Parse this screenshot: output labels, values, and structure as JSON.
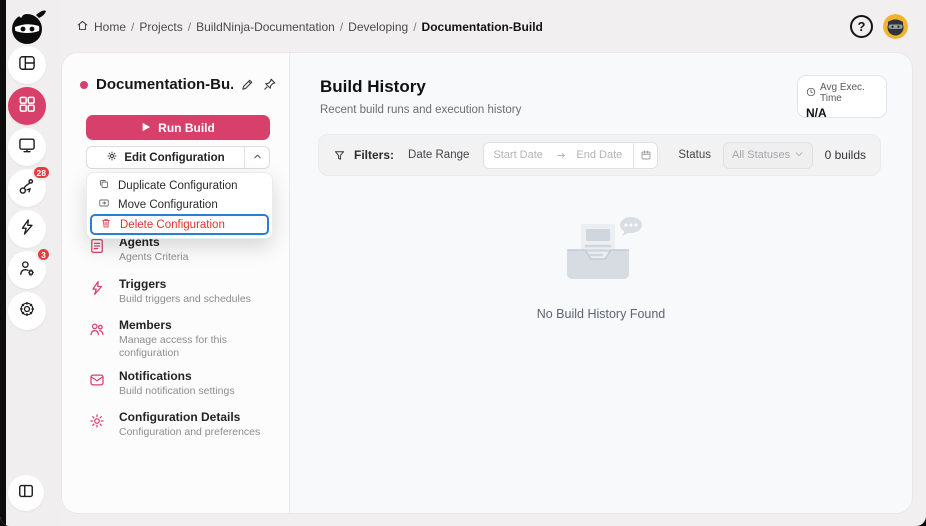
{
  "topbar": {
    "breadcrumb": {
      "separator": "/",
      "items": [
        "Home",
        "Projects",
        "BuildNinja-Documentation",
        "Developing",
        "Documentation-Build"
      ]
    },
    "help_glyph": "?"
  },
  "sidebar": {
    "badges": {
      "pipelines": "28",
      "users": "3"
    }
  },
  "config_panel": {
    "title": "Documentation-Bu...",
    "run_build_label": "Run Build",
    "edit_config_label": "Edit Configuration",
    "menu": {
      "items": [
        {
          "label": "Duplicate Configuration"
        },
        {
          "label": "Move Configuration"
        },
        {
          "label": "Delete Configuration"
        }
      ]
    },
    "nav": {
      "items": [
        {
          "title": "Agents",
          "subtitle": "Agents Criteria"
        },
        {
          "title": "Triggers",
          "subtitle": "Build triggers and schedules"
        },
        {
          "title": "Members",
          "subtitle": "Manage access for this configuration"
        },
        {
          "title": "Notifications",
          "subtitle": "Build notification settings"
        },
        {
          "title": "Configuration Details",
          "subtitle": "Configuration and preferences"
        }
      ]
    }
  },
  "main": {
    "title": "Build History",
    "subtitle": "Recent build runs and execution history",
    "avg_card": {
      "label": "Avg Exec. Time",
      "value": "N/A"
    },
    "filters": {
      "label": "Filters:",
      "date_range_label": "Date Range",
      "start_placeholder": "Start Date",
      "end_placeholder": "End Date",
      "status_label": "Status",
      "status_value": "All Statuses",
      "builds_count": "0 builds"
    },
    "empty_state": {
      "message": "No Build History Found"
    }
  },
  "colors": {
    "accent": "#d6406a",
    "badge_red": "#e23d3d",
    "delete_red": "#e03131",
    "highlight_blue": "#2e7dd1"
  }
}
